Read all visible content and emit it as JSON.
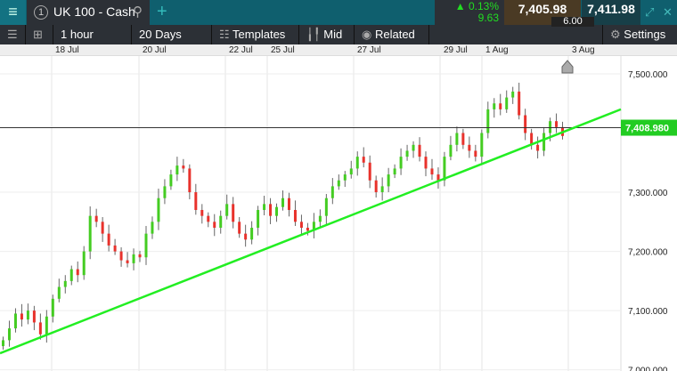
{
  "header": {
    "menu_icon": "hamburger-icon",
    "tab_number": "1",
    "tab_title": "UK 100 - Cash",
    "change_pct": "▲ 0.13%",
    "change_pts": "9.63",
    "sell_price": "7,405.98",
    "buy_price": "7,411.98",
    "spread": "6.00"
  },
  "toolbar": {
    "interval": "1 hour",
    "range": "20 Days",
    "templates": "Templates",
    "price_type": "Mid",
    "related": "Related",
    "settings": "Settings"
  },
  "colors": {
    "up": "#44cc22",
    "down": "#e8322c",
    "trendline": "#22ee22",
    "current_price": "#22cc22"
  },
  "chart_data": {
    "type": "candlestick",
    "instrument": "UK 100 - Cash",
    "x_ticks": [
      "18 Jul",
      "20 Jul",
      "22 Jul",
      "25 Jul",
      "27 Jul",
      "29 Jul",
      "1 Aug",
      "3 Aug"
    ],
    "y_ticks": [
      "7,500.000",
      "7,300.000",
      "7,200.000",
      "7,100.000",
      "7,000.000"
    ],
    "y_tick_values": [
      7500,
      7300,
      7200,
      7100,
      7000
    ],
    "ylim": [
      6998,
      7530
    ],
    "current_price_label": "7,408.980",
    "current_price": 7408.98,
    "trendline": {
      "start": 7028,
      "end": 7440
    },
    "closes": [
      7050,
      7070,
      7095,
      7085,
      7100,
      7080,
      7060,
      7090,
      7120,
      7140,
      7150,
      7170,
      7160,
      7200,
      7260,
      7250,
      7230,
      7210,
      7200,
      7185,
      7180,
      7195,
      7190,
      7230,
      7250,
      7290,
      7310,
      7330,
      7345,
      7340,
      7300,
      7270,
      7260,
      7250,
      7240,
      7260,
      7280,
      7250,
      7230,
      7220,
      7240,
      7270,
      7280,
      7260,
      7275,
      7290,
      7270,
      7250,
      7240,
      7235,
      7250,
      7260,
      7290,
      7310,
      7320,
      7330,
      7340,
      7360,
      7350,
      7320,
      7300,
      7310,
      7330,
      7340,
      7360,
      7370,
      7380,
      7360,
      7340,
      7330,
      7320,
      7360,
      7380,
      7400,
      7380,
      7370,
      7360,
      7400,
      7440,
      7450,
      7440,
      7460,
      7470,
      7430,
      7400,
      7380,
      7370,
      7400,
      7420,
      7410,
      7395
    ]
  }
}
